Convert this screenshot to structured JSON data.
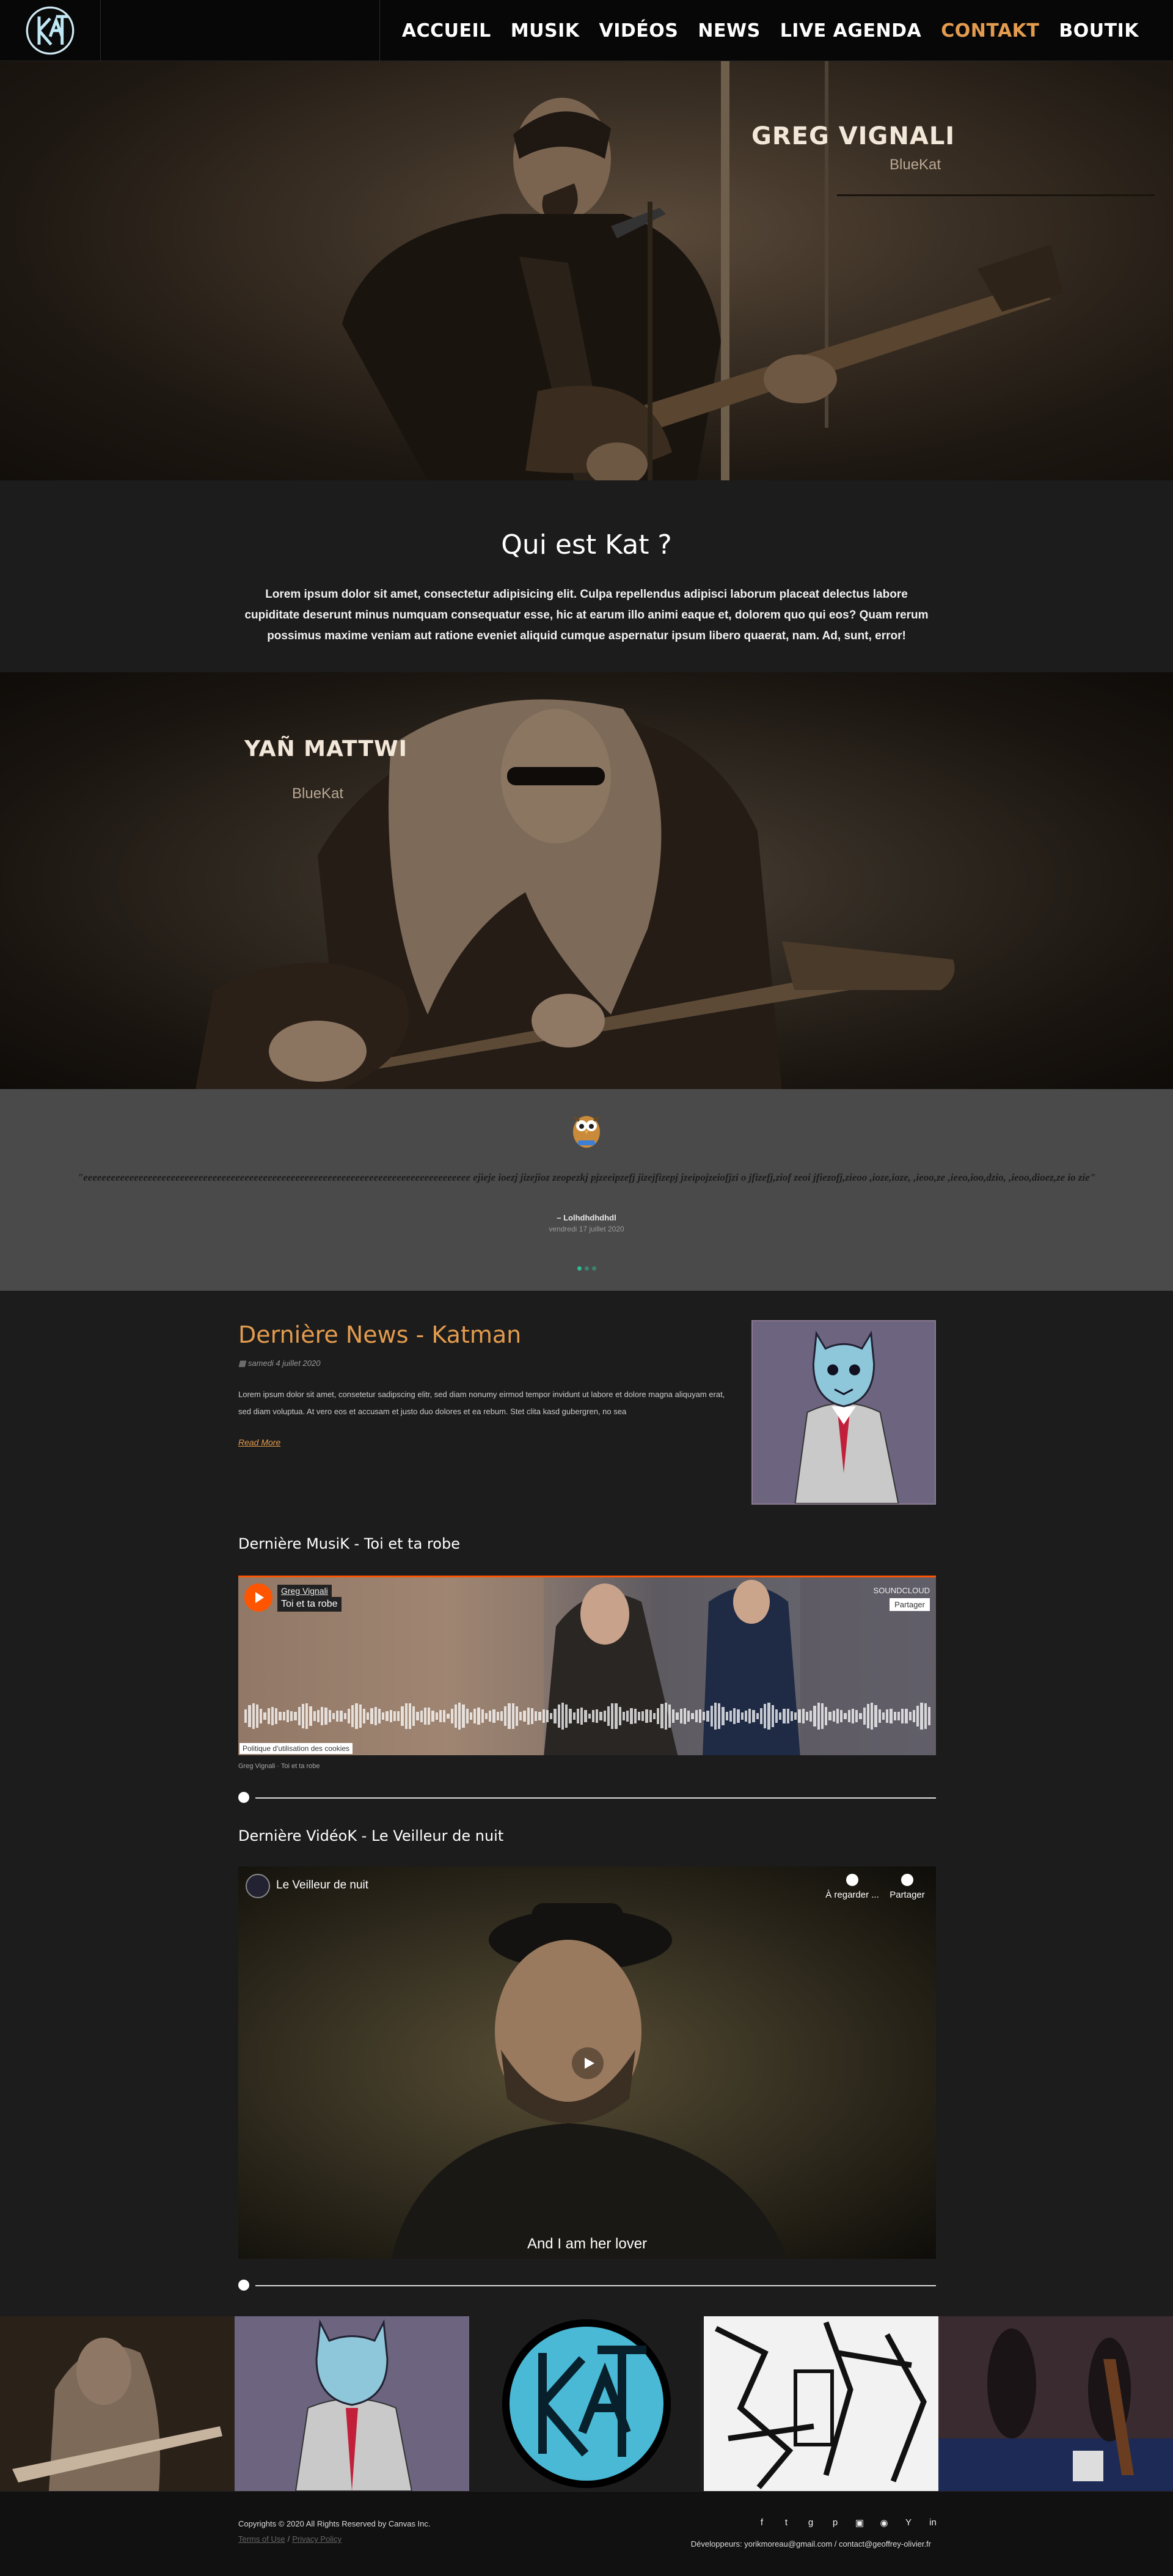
{
  "header": {
    "nav": [
      "ACCUEIL",
      "MUSIK",
      "VIDÉOS",
      "NEWS",
      "LIVE AGENDA",
      "CONTAKT",
      "BOUTIK"
    ],
    "active": "CONTAKT",
    "accent_color": "#e39b4e"
  },
  "hero1": {
    "title": "GREG VIGNALI",
    "subtitle": "BlueKat"
  },
  "about": {
    "heading": "Qui est Kat ?",
    "text": "Lorem ipsum dolor sit amet, consectetur adipisicing elit. Culpa repellendus adipisci laborum placeat delectus labore cupiditate deserunt minus numquam consequatur esse, hic at earum illo animi eaque et, dolorem quo qui eos? Quam rerum possimus maxime veniam aut ratione eveniet aliquid cumque aspernatur ipsum libero quaerat, nam. Ad, sunt, error!"
  },
  "hero2": {
    "title": "YAÑ MATTWI",
    "subtitle": "BlueKat"
  },
  "testimonial": {
    "quote": "\"eeeeeeeeeeeeeeeeeeeeeeeeeeeeeeeeeeeeeeeeeeeeeeeeeeeeeeeeeeeeeeeeeeeeeeeeeeeeeeeeeeee ejieje ioezj jizejioz zeopezkj pjzeeipzefj jizejfizepj jzeipojzeiofjzi o jfizefj,ziof zeoi jfiezofj,zieoo ,ioze,ioze, ,ieoo,ze ,ieeo,ioo,dzio, ,ieoo,dioez,ze io zie\"",
    "author": "– Lolhdhdhdhdl",
    "date": "vendredi 17 juillet 2020"
  },
  "news": {
    "title": "Dernière News - Katman",
    "date": "samedi 4 juillet 2020",
    "body": "Lorem ipsum dolor sit amet, consetetur sadipscing elitr, sed diam nonumy eirmod tempor invidunt ut labore et dolore magna aliquyam erat, sed diam voluptua. At vero eos et accusam et justo duo dolores et ea rebum. Stet clita kasd gubergren, no sea",
    "read_more": "Read More"
  },
  "musik": {
    "heading": "Dernière MusiK - Toi et ta robe",
    "artist": "Greg Vignali",
    "track": "Toi et ta robe",
    "brand": "SOUNDCLOUD",
    "share": "Partager",
    "cookie": "Politique d'utilisation des cookies",
    "meta": "Greg Vignali · Toi et ta robe"
  },
  "video": {
    "heading": "Dernière VidéoK - Le Veilleur de nuit",
    "title": "Le Veilleur de nuit",
    "watch_later": "À regarder ...",
    "share": "Partager",
    "caption": "And I am her lover"
  },
  "footer": {
    "copyright": "Copyrights © 2020 All Rights Reserved by Canvas Inc.",
    "terms": "Terms of Use",
    "privacy": "Privacy Policy",
    "developers": "Développeurs: yorikmoreau@gmail.com / contact@geoffrey-olivier.fr"
  }
}
